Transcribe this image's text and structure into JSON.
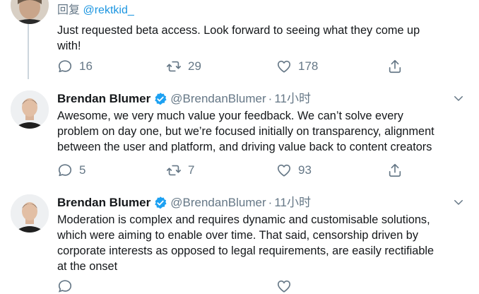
{
  "colors": {
    "text": "#14171a",
    "secondary": "#657786",
    "link": "#1b95e0",
    "verified": "#1da1f2",
    "thread_line": "#ccd6dd"
  },
  "tweets": [
    {
      "reply_prefix": "回复",
      "reply_mention": "@rektkid_",
      "text": "Just requested beta access. Look forward to seeing what they come up\nwith!",
      "stats": {
        "replies": "16",
        "retweets": "29",
        "likes": "178"
      }
    },
    {
      "author_name": "Brendan Blumer",
      "handle": "@BrendanBlumer",
      "separator": "·",
      "time": "11小时",
      "text": "Awesome, we very much value your feedback. We can’t solve every\nproblem on day one, but we’re focused initially on transparency, alignment\nbetween the user and platform, and driving value back to content creators",
      "stats": {
        "replies": "5",
        "retweets": "7",
        "likes": "93"
      }
    },
    {
      "author_name": "Brendan Blumer",
      "handle": "@BrendanBlumer",
      "separator": "·",
      "time": "11小时",
      "text": "Moderation is complex and requires dynamic and customisable solutions,\nwhich were aiming to enable over time. That said, censorship driven by\ncorporate interests as opposed to legal requirements, are easily rectifiable\nat the onset"
    }
  ],
  "icons": {
    "reply": "reply-icon",
    "retweet": "retweet-icon",
    "like": "heart-icon",
    "share": "share-icon",
    "more": "chevron-down-icon",
    "verified": "verified-badge-icon"
  }
}
